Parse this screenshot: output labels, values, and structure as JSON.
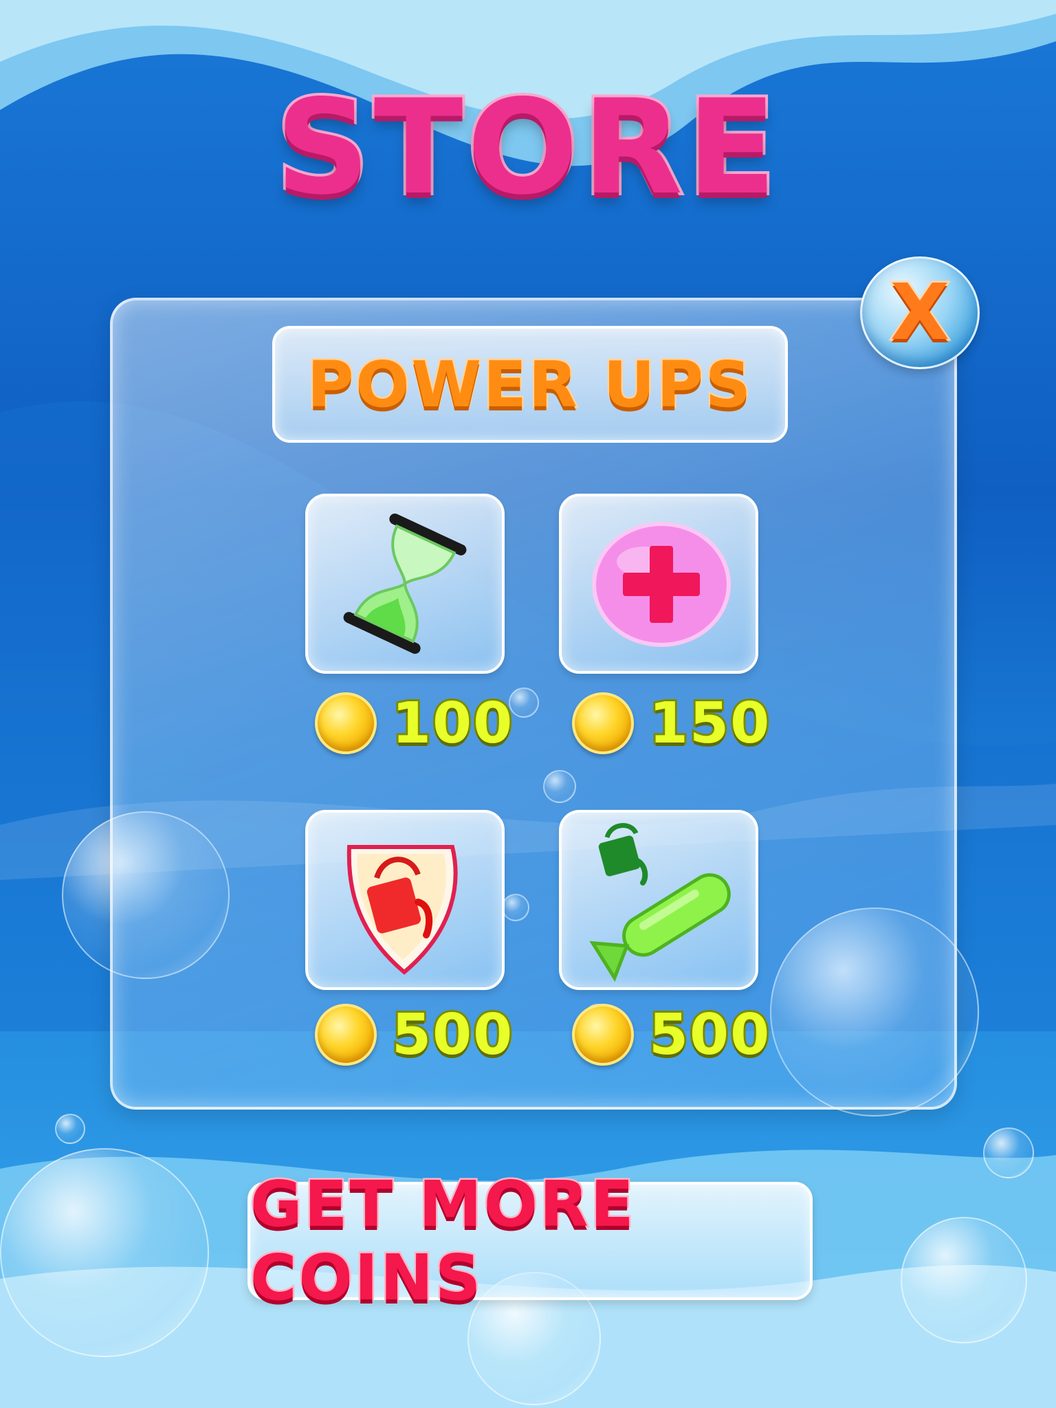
{
  "store": {
    "title": "STORE",
    "close_label": "X",
    "section_title": "POWER UPS",
    "items": [
      {
        "icon": "hourglass-icon",
        "price": "100"
      },
      {
        "icon": "health-plus-icon",
        "price": "150"
      },
      {
        "icon": "paint-shield-icon",
        "price": "500"
      },
      {
        "icon": "paint-bomb-icon",
        "price": "500"
      }
    ],
    "cta_label": "GET MORE COINS"
  },
  "colors": {
    "title": "#ec2f8d",
    "section_title": "#ff8c12",
    "price": "#e8ff2a",
    "cta": "#f4184c",
    "close": "#ff7a1a"
  }
}
